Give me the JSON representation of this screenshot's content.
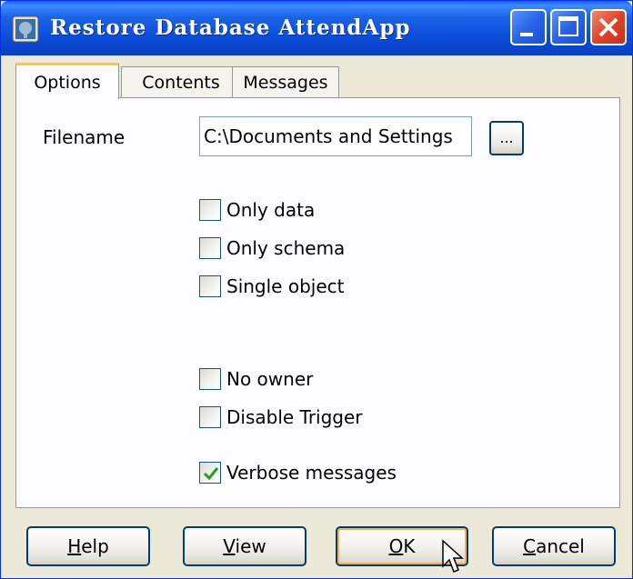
{
  "window": {
    "title": "Restore Database AttendApp"
  },
  "titlebar_buttons": {
    "minimize": "minimize",
    "maximize": "maximize",
    "close": "close"
  },
  "tabs": [
    {
      "label": "Options",
      "active": true
    },
    {
      "label": "Contents",
      "active": false
    },
    {
      "label": "Messages",
      "active": false
    }
  ],
  "options": {
    "filename_label": "Filename",
    "filename_value": "C:\\Documents and Settings",
    "browse_label": "...",
    "checkboxes": [
      {
        "label": "Only data",
        "checked": false
      },
      {
        "label": "Only schema",
        "checked": false
      },
      {
        "label": "Single object",
        "checked": false
      },
      {
        "label": "No owner",
        "checked": false
      },
      {
        "label": "Disable Trigger",
        "checked": false
      },
      {
        "label": "Verbose messages",
        "checked": true
      }
    ]
  },
  "buttons": {
    "help": {
      "rest": "elp",
      "accel": "H"
    },
    "view": {
      "rest": "iew",
      "accel": "V"
    },
    "ok": {
      "rest": "K",
      "accel": "O"
    },
    "cancel": {
      "rest": "ancel",
      "accel": "C"
    }
  },
  "colors": {
    "titlebar": "#0a4bd8",
    "close_button": "#e0442a",
    "tab_highlight": "#ffc83c",
    "checkmark": "#21a121"
  }
}
